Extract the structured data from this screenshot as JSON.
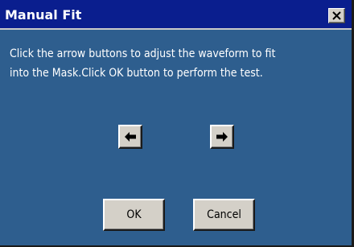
{
  "window": {
    "title": "Manual Fit",
    "close_icon": "close-icon"
  },
  "message": "Click the arrow buttons to adjust the waveform to fit\ninto the Mask.Click OK button to perform the test.",
  "arrows": {
    "left_icon": "arrow-left-icon",
    "right_icon": "arrow-right-icon"
  },
  "buttons": {
    "ok_label": "OK",
    "cancel_label": "Cancel"
  },
  "colors": {
    "titlebar": "#0a1e8e",
    "body": "#2e5e8e",
    "button_face": "#d4d0c8",
    "text": "#ffffff"
  }
}
